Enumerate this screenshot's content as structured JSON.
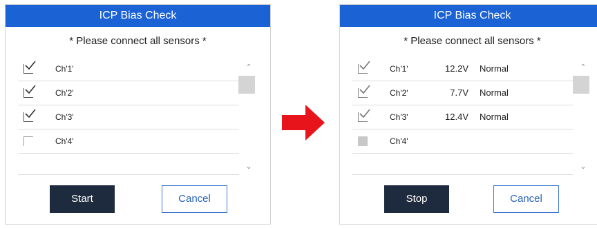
{
  "dialogs": [
    {
      "title": "ICP Bias Check",
      "instruction": "* Please connect all sensors *",
      "channels": [
        {
          "label": "Ch'1'",
          "state": "checked",
          "voltage": "",
          "status": ""
        },
        {
          "label": "Ch'2'",
          "state": "checked",
          "voltage": "",
          "status": ""
        },
        {
          "label": "Ch'3'",
          "state": "checked",
          "voltage": "",
          "status": ""
        },
        {
          "label": "Ch'4'",
          "state": "unchecked",
          "voltage": "",
          "status": ""
        }
      ],
      "primary_button": "Start",
      "secondary_button": "Cancel"
    },
    {
      "title": "ICP Bias Check",
      "instruction": "* Please connect all sensors *",
      "channels": [
        {
          "label": "Ch'1'",
          "state": "checked-disabled",
          "voltage": "12.2V",
          "status": "Normal"
        },
        {
          "label": "Ch'2'",
          "state": "checked-disabled",
          "voltage": "7.7V",
          "status": "Normal"
        },
        {
          "label": "Ch'3'",
          "state": "checked-disabled",
          "voltage": "12.4V",
          "status": "Normal"
        },
        {
          "label": "Ch'4'",
          "state": "unchecked-disabled",
          "voltage": "",
          "status": ""
        }
      ],
      "primary_button": "Stop",
      "secondary_button": "Cancel"
    }
  ],
  "colors": {
    "title_bar": "#1b63d4",
    "primary_button": "#1e2b3e",
    "secondary_border": "#3a76d0",
    "arrow": "#e8141c"
  },
  "icons": {
    "scroll_up": "chevron-up-icon",
    "scroll_down": "chevron-down-icon",
    "transition": "right-arrow-icon",
    "check": "checkmark-icon"
  }
}
